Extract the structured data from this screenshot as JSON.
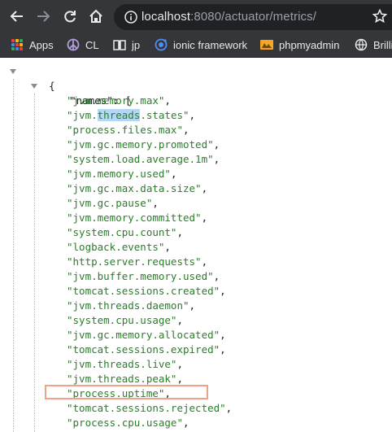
{
  "browser": {
    "url_host": "localhost",
    "url_rest": ":8080/actuator/metrics/",
    "bookmarks": [
      {
        "label": "Apps",
        "icon": "apps-grid-icon"
      },
      {
        "label": "CL",
        "icon": "peace-icon"
      },
      {
        "label": "jp",
        "icon": "book-icon"
      },
      {
        "label": "ionic framework",
        "icon": "ionic-icon"
      },
      {
        "label": "phpmyadmin",
        "icon": "pma-icon"
      },
      {
        "label": "Brilli",
        "icon": "globe-icon"
      }
    ],
    "colors": {
      "toolbar": "#35363a",
      "omnibox": "#202124",
      "highlight": "#f0a286",
      "string": "#2a7e2a"
    }
  },
  "json_view": {
    "open_brace": "{",
    "key": "\"names\"",
    "key_sep": ": [",
    "selected_word": "threads",
    "highlighted_item": "\"process.uptime\"",
    "items": [
      "jvm.memory.max",
      "jvm.threads.states",
      "process.files.max",
      "jvm.gc.memory.promoted",
      "system.load.average.1m",
      "jvm.memory.used",
      "jvm.gc.max.data.size",
      "jvm.gc.pause",
      "jvm.memory.committed",
      "system.cpu.count",
      "logback.events",
      "http.server.requests",
      "jvm.buffer.memory.used",
      "tomcat.sessions.created",
      "jvm.threads.daemon",
      "system.cpu.usage",
      "jvm.gc.memory.allocated",
      "tomcat.sessions.expired",
      "jvm.threads.live",
      "jvm.threads.peak",
      "process.uptime",
      "tomcat.sessions.rejected",
      "process.cpu.usage"
    ]
  }
}
